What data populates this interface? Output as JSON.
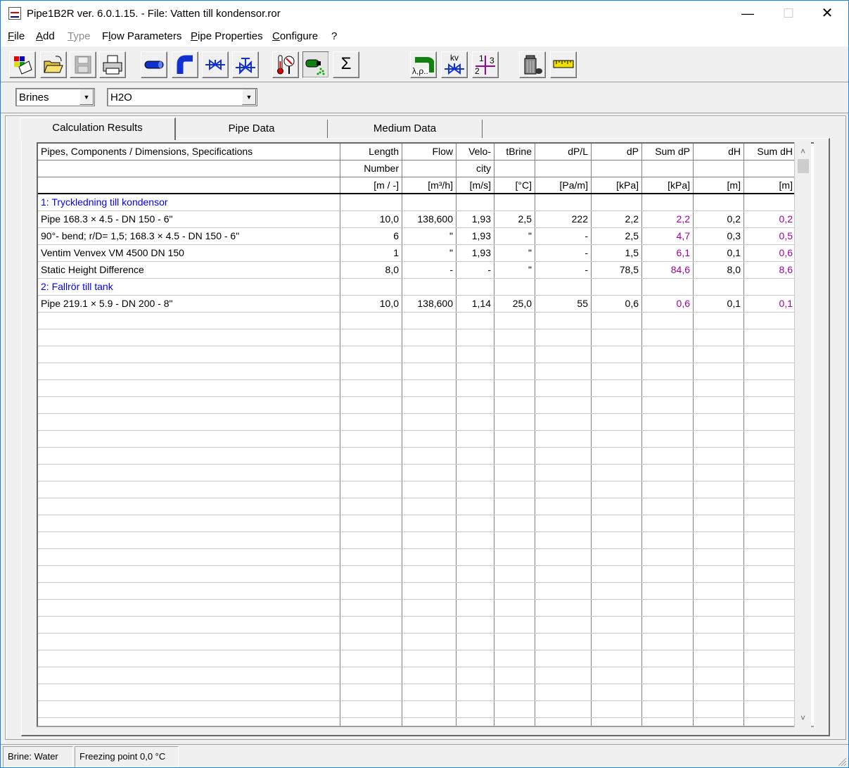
{
  "window": {
    "title": "Pipe1B2R ver. 6.0.1.15. - File: Vatten till kondensor.ror",
    "min_glyph": "—",
    "max_glyph": "☐",
    "close_glyph": "✕"
  },
  "menu": {
    "file_u": "F",
    "file_rest": "ile",
    "add_u": "A",
    "add_rest": "dd",
    "type_u": "T",
    "type_rest": "ype",
    "flow_pre": "F",
    "flow_u": "l",
    "flow_rest": "ow Parameters",
    "pipe_u": "P",
    "pipe_rest": "ipe Properties",
    "conf_u": "C",
    "conf_rest": "onfigure",
    "help": "?"
  },
  "toolbar": {
    "icons": [
      "new-icon",
      "open-icon",
      "save-icon",
      "print-icon",
      "pipe-icon",
      "bend-icon",
      "valve-icon",
      "control-valve-icon",
      "thermometer-icon",
      "brine-icon",
      "sum-icon",
      "lambda-icon",
      "kv-icon",
      "tee-icon",
      "trash-icon",
      "ruler-icon"
    ],
    "sum_glyph": "Σ",
    "lambda_text": "λ,ρ..",
    "kv_text": "kv",
    "tee_numbers": [
      "1",
      "3",
      "2"
    ]
  },
  "selectors": {
    "medium_type": "Brines",
    "medium": "H2O"
  },
  "tabs": [
    {
      "label": "Calculation Results"
    },
    {
      "label": "Pipe Data"
    },
    {
      "label": "Medium Data"
    }
  ],
  "grid": {
    "columns": [
      {
        "h1": "Pipes, Components / Dimensions, Specifications",
        "h2": "",
        "h3": ""
      },
      {
        "h1": "Length",
        "h2": "Number",
        "h3": "[m / -]"
      },
      {
        "h1": "Flow",
        "h2": "",
        "h3": "[m³/h]"
      },
      {
        "h1": "Velo-",
        "h2": "city",
        "h3": "[m/s]"
      },
      {
        "h1": "tBrine",
        "h2": "",
        "h3": "[°C]"
      },
      {
        "h1": "dP/L",
        "h2": "",
        "h3": "[Pa/m]"
      },
      {
        "h1": "dP",
        "h2": "",
        "h3": "[kPa]"
      },
      {
        "h1": "Sum dP",
        "h2": "",
        "h3": "[kPa]"
      },
      {
        "h1": "dH",
        "h2": "",
        "h3": "[m]"
      },
      {
        "h1": "Sum dH",
        "h2": "",
        "h3": "[m]"
      }
    ],
    "rows": [
      {
        "group": true,
        "cells": [
          "1: Tryckledning till kondensor",
          "",
          "",
          "",
          "",
          "",
          "",
          "",
          "",
          ""
        ]
      },
      {
        "group": false,
        "cells": [
          "Pipe 168.3 × 4.5 - DN 150 - 6\"",
          "10,0",
          "138,600",
          "1,93",
          "2,5",
          "222",
          "2,2",
          "2,2",
          "0,2",
          "0,2"
        ]
      },
      {
        "group": false,
        "cells": [
          "90°- bend; r/D= 1,5; 168.3 × 4.5 - DN 150 - 6\"",
          "6",
          "\"",
          "1,93",
          "\"",
          "-",
          "2,5",
          "4,7",
          "0,3",
          "0,5"
        ]
      },
      {
        "group": false,
        "cells": [
          "Ventim Venvex VM 4500 DN 150",
          "1",
          "\"",
          "1,93",
          "\"",
          "-",
          "1,5",
          "6,1",
          "0,1",
          "0,6"
        ]
      },
      {
        "group": false,
        "cells": [
          "Static Height Difference",
          "8,0",
          "-",
          "-",
          "\"",
          "-",
          "78,5",
          "84,6",
          "8,0",
          "8,6"
        ]
      },
      {
        "group": true,
        "cells": [
          "2: Fallrör till tank",
          "",
          "",
          "",
          "",
          "",
          "",
          "",
          "",
          ""
        ]
      },
      {
        "group": false,
        "cells": [
          "Pipe 219.1 × 5.9 - DN 200 - 8\"",
          "10,0",
          "138,600",
          "1,14",
          "25,0",
          "55",
          "0,6",
          "0,6",
          "0,1",
          "0,1"
        ]
      }
    ],
    "scroll_up": "˄",
    "scroll_down": "˅"
  },
  "status": {
    "brine": "Brine:  Water",
    "freezing": "Freezing point 0,0 °C"
  },
  "colors": {
    "group_text": "#0000ff",
    "sum_text": "#a000a0",
    "accent_border": "#1883d7"
  }
}
